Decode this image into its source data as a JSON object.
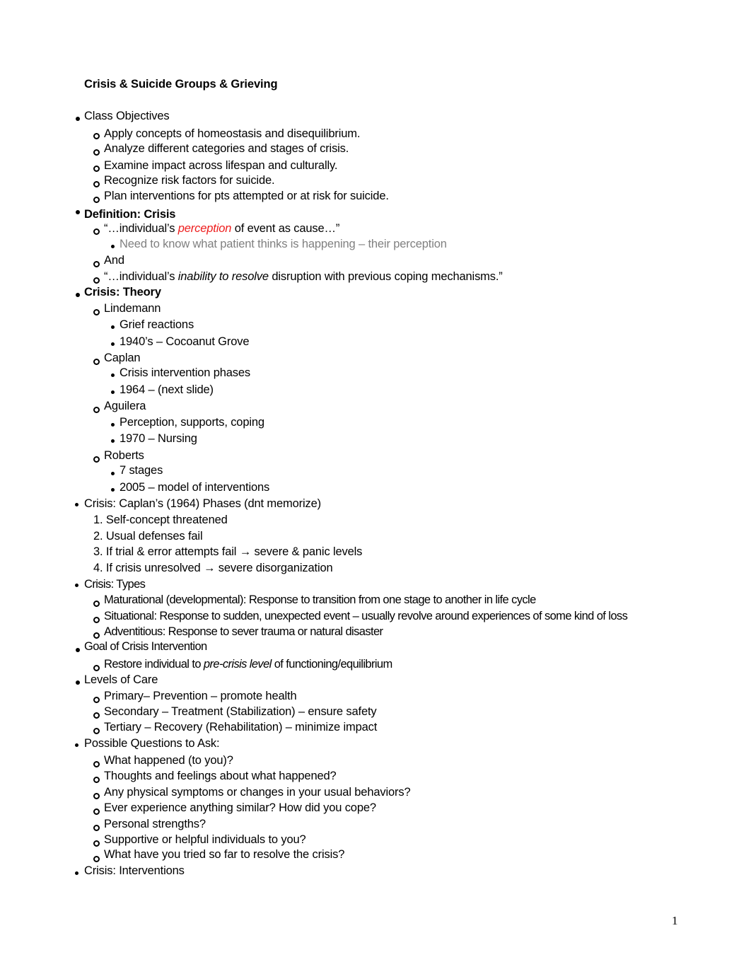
{
  "document": {
    "title": "Crisis & Suicide Groups & Grieving",
    "page_number": "1",
    "colors": {
      "emphasis_red": "#ee1c1c",
      "note_gray": "#808080"
    }
  },
  "sections": {
    "objectives": {
      "heading": "Class Objectives",
      "items": [
        "Apply concepts of homeostasis and disequilibrium.",
        "Analyze different categories and stages of crisis.",
        "Examine impact across lifespan and culturally.",
        "Recognize risk factors for suicide.",
        "Plan interventions for pts attempted or at risk for suicide."
      ]
    },
    "definition": {
      "heading": "Definition: Crisis",
      "item1_pre": "“…individual’s ",
      "item1_em": "perception",
      "item1_post": " of event as cause…”",
      "item1_note": "Need to know what patient thinks is happening – their perception",
      "item2": "And",
      "item3_pre": "“…individual’s ",
      "item3_em": "inability to resolve",
      "item3_post": " disruption with previous coping mechanisms.”"
    },
    "theory": {
      "heading": "Crisis: Theory",
      "theorists": [
        {
          "name": "Lindemann",
          "notes": [
            "Grief reactions",
            "1940’s – Cocoanut Grove"
          ]
        },
        {
          "name": "Caplan",
          "notes": [
            "Crisis intervention phases",
            "1964 – (next slide)"
          ]
        },
        {
          "name": "Aguilera",
          "notes": [
            "Perception, supports, coping",
            "1970 – Nursing"
          ]
        },
        {
          "name": "Roberts",
          "notes": [
            "7 stages",
            "2005 – model of interventions"
          ]
        }
      ]
    },
    "phases": {
      "heading": "Crisis: Caplan’s (1964) Phases (dnt memorize)",
      "items": [
        "1. Self-concept threatened",
        "2. Usual defenses fail",
        "3. If trial & error attempts fail → severe & panic levels",
        "4. If crisis unresolved → severe disorganization"
      ]
    },
    "types": {
      "heading": "Crisis: Types",
      "items": [
        "Maturational (developmental): Response to transition from one stage to another in life cycle",
        "Situational: Response to sudden, unexpected event – usually revolve around experiences of some kind of loss",
        "Adventitious: Response to sever trauma or natural disaster"
      ]
    },
    "goal": {
      "heading": "Goal of Crisis Intervention",
      "item_pre": "Restore individual to ",
      "item_em": "pre-crisis level",
      "item_post": " of functioning/equilibrium"
    },
    "levels": {
      "heading": "Levels of Care",
      "items": [
        "Primary– Prevention – promote health",
        "Secondary – Treatment (Stabilization) – ensure safety",
        "Tertiary – Recovery (Rehabilitation) – minimize impact"
      ]
    },
    "questions": {
      "heading": "Possible Questions to Ask:",
      "items": [
        "What happened (to you)?",
        "Thoughts and feelings about what happened?",
        "Any physical symptoms or changes in your usual behaviors?",
        "Ever experience anything similar? How did you cope?",
        "Personal strengths?",
        "Supportive or helpful individuals to you?",
        "What have you tried so far to resolve the crisis?"
      ]
    },
    "interventions": {
      "heading": "Crisis: Interventions"
    }
  }
}
